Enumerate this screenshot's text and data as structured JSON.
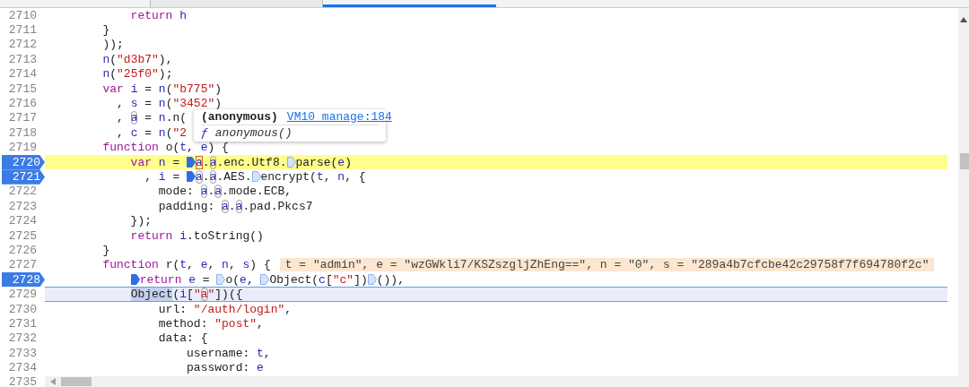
{
  "tab_strip": {
    "tabs": [
      {
        "selected": false
      },
      {
        "selected": true
      }
    ]
  },
  "lines": [
    {
      "number": "2710",
      "tokens": [
        {
          "kind": "kw",
          "text": "            return"
        },
        {
          "kind": "id",
          "text": " h"
        }
      ]
    },
    {
      "number": "2711",
      "tokens": [
        {
          "kind": "txt",
          "text": "        }"
        }
      ]
    },
    {
      "number": "2712",
      "tokens": [
        {
          "kind": "txt",
          "text": "        ));"
        }
      ]
    },
    {
      "number": "2713",
      "tokens": [
        {
          "kind": "id",
          "text": "        n"
        },
        {
          "kind": "txt",
          "text": "("
        },
        {
          "kind": "str",
          "text": "\"d3b7\""
        },
        {
          "kind": "txt",
          "text": "),"
        }
      ]
    },
    {
      "number": "2714",
      "tokens": [
        {
          "kind": "id",
          "text": "        n"
        },
        {
          "kind": "txt",
          "text": "("
        },
        {
          "kind": "str",
          "text": "\"25f0\""
        },
        {
          "kind": "txt",
          "text": ");"
        }
      ]
    },
    {
      "number": "2715",
      "tokens": [
        {
          "kind": "kw",
          "text": "        var"
        },
        {
          "kind": "id",
          "text": " i"
        },
        {
          "kind": "txt",
          "text": " = "
        },
        {
          "kind": "id",
          "text": "n"
        },
        {
          "kind": "txt",
          "text": "("
        },
        {
          "kind": "str",
          "text": "\"b775\""
        },
        {
          "kind": "txt",
          "text": ")"
        }
      ]
    },
    {
      "number": "2716",
      "tokens": [
        {
          "kind": "txt",
          "text": "          , "
        },
        {
          "kind": "id",
          "text": "s"
        },
        {
          "kind": "txt",
          "text": " = "
        },
        {
          "kind": "id",
          "text": "n"
        },
        {
          "kind": "txt",
          "text": "("
        },
        {
          "kind": "str",
          "text": "\"3452\""
        },
        {
          "kind": "txt",
          "text": ")"
        }
      ]
    },
    {
      "number": "2717",
      "tokens": [
        {
          "kind": "txt",
          "text": "          , "
        },
        {
          "kind": "ref",
          "text": "a"
        },
        {
          "kind": "txt",
          "text": " = "
        },
        {
          "kind": "id",
          "text": "n"
        },
        {
          "kind": "txt",
          "text": ".n("
        }
      ]
    },
    {
      "number": "2718",
      "tokens": [
        {
          "kind": "txt",
          "text": "          , "
        },
        {
          "kind": "id",
          "text": "c"
        },
        {
          "kind": "txt",
          "text": " = "
        },
        {
          "kind": "id",
          "text": "n"
        },
        {
          "kind": "txt",
          "text": "("
        },
        {
          "kind": "str",
          "text": "\"2"
        }
      ]
    },
    {
      "number": "2719",
      "tokens": [
        {
          "kind": "kw",
          "text": "        function"
        },
        {
          "kind": "txt",
          "text": " o("
        },
        {
          "kind": "id",
          "text": "t"
        },
        {
          "kind": "txt",
          "text": ", "
        },
        {
          "kind": "id",
          "text": "e"
        },
        {
          "kind": "txt",
          "text": ") {"
        }
      ]
    },
    {
      "number": "2720",
      "breakpoint": true,
      "paused": true,
      "tokens": [
        {
          "kind": "kw",
          "text": "            var"
        },
        {
          "kind": "id",
          "text": " n"
        },
        {
          "kind": "txt",
          "text": " = "
        },
        {
          "kind": "ref-hot",
          "text": "a",
          "bp": true
        },
        {
          "kind": "txt",
          "text": "."
        },
        {
          "kind": "ref",
          "text": "a"
        },
        {
          "kind": "txt",
          "text": ".enc.Utf8."
        },
        {
          "kind": "txt",
          "text": "parse(",
          "bp": false
        },
        {
          "kind": "id",
          "text": "e"
        },
        {
          "kind": "txt",
          "text": ")"
        }
      ]
    },
    {
      "number": "2721",
      "breakpoint": true,
      "tokens": [
        {
          "kind": "txt",
          "text": "              , "
        },
        {
          "kind": "id",
          "text": "i"
        },
        {
          "kind": "txt",
          "text": " = "
        },
        {
          "kind": "ref",
          "text": "a",
          "bp": true
        },
        {
          "kind": "txt",
          "text": "."
        },
        {
          "kind": "ref",
          "text": "a"
        },
        {
          "kind": "txt",
          "text": ".AES."
        },
        {
          "kind": "txt",
          "text": "encrypt(",
          "bp": false
        },
        {
          "kind": "id",
          "text": "t"
        },
        {
          "kind": "txt",
          "text": ", "
        },
        {
          "kind": "id",
          "text": "n"
        },
        {
          "kind": "txt",
          "text": ", {"
        }
      ]
    },
    {
      "number": "2722",
      "tokens": [
        {
          "kind": "txt",
          "text": "                mode: "
        },
        {
          "kind": "ref",
          "text": "a"
        },
        {
          "kind": "txt",
          "text": "."
        },
        {
          "kind": "ref",
          "text": "a"
        },
        {
          "kind": "txt",
          "text": ".mode.ECB,"
        }
      ]
    },
    {
      "number": "2723",
      "tokens": [
        {
          "kind": "txt",
          "text": "                padding: "
        },
        {
          "kind": "ref",
          "text": "a"
        },
        {
          "kind": "txt",
          "text": "."
        },
        {
          "kind": "ref",
          "text": "a"
        },
        {
          "kind": "txt",
          "text": ".pad.Pkcs7"
        }
      ]
    },
    {
      "number": "2724",
      "tokens": [
        {
          "kind": "txt",
          "text": "            });"
        }
      ]
    },
    {
      "number": "2725",
      "tokens": [
        {
          "kind": "kw",
          "text": "            return"
        },
        {
          "kind": "id",
          "text": " i"
        },
        {
          "kind": "txt",
          "text": ".toString()"
        }
      ]
    },
    {
      "number": "2726",
      "tokens": [
        {
          "kind": "txt",
          "text": "        }"
        }
      ]
    },
    {
      "number": "2727",
      "inline_values": "t = \"admin\", e = \"wzGWkli7/KSZszgljZhEng==\", n = \"0\", s = \"289a4b7cfcbe42c29758f7f694780f2c\"",
      "tokens": [
        {
          "kind": "kw",
          "text": "        function"
        },
        {
          "kind": "txt",
          "text": " r("
        },
        {
          "kind": "id",
          "text": "t"
        },
        {
          "kind": "txt",
          "text": ", "
        },
        {
          "kind": "id",
          "text": "e"
        },
        {
          "kind": "txt",
          "text": ", "
        },
        {
          "kind": "id",
          "text": "n"
        },
        {
          "kind": "txt",
          "text": ", "
        },
        {
          "kind": "id",
          "text": "s"
        },
        {
          "kind": "txt",
          "text": ") {"
        }
      ]
    },
    {
      "number": "2728",
      "breakpoint": true,
      "tokens": [
        {
          "kind": "kw",
          "text": "            return",
          "bp": true
        },
        {
          "kind": "id",
          "text": " e"
        },
        {
          "kind": "txt",
          "text": " = "
        },
        {
          "kind": "txt",
          "text": "o(",
          "bp": false
        },
        {
          "kind": "id",
          "text": "e"
        },
        {
          "kind": "txt",
          "text": ", "
        },
        {
          "kind": "txt",
          "text": "Object(",
          "bp": false
        },
        {
          "kind": "id",
          "text": "c"
        },
        {
          "kind": "txt",
          "text": "["
        },
        {
          "kind": "str",
          "text": "\"c\""
        },
        {
          "kind": "txt",
          "text": "])"
        },
        {
          "kind": "txt",
          "text": "()),",
          "bp": false
        }
      ]
    },
    {
      "number": "2729",
      "current": true,
      "tokens": [
        {
          "kind": "sel",
          "text": "            Object"
        },
        {
          "kind": "txt",
          "text": "("
        },
        {
          "kind": "id",
          "text": "i"
        },
        {
          "kind": "txt",
          "text": "["
        },
        {
          "kind": "str",
          "text": "\""
        },
        {
          "kind": "ref-str",
          "text": "a"
        },
        {
          "kind": "str",
          "text": "\""
        },
        {
          "kind": "txt",
          "text": "])({"
        }
      ]
    },
    {
      "number": "2730",
      "tokens": [
        {
          "kind": "txt",
          "text": "                url: "
        },
        {
          "kind": "str",
          "text": "\"/auth/login\""
        },
        {
          "kind": "txt",
          "text": ","
        }
      ]
    },
    {
      "number": "2731",
      "tokens": [
        {
          "kind": "txt",
          "text": "                method: "
        },
        {
          "kind": "str",
          "text": "\"post\""
        },
        {
          "kind": "txt",
          "text": ","
        }
      ]
    },
    {
      "number": "2732",
      "tokens": [
        {
          "kind": "txt",
          "text": "                data: {"
        }
      ]
    },
    {
      "number": "2733",
      "tokens": [
        {
          "kind": "txt",
          "text": "                    username: "
        },
        {
          "kind": "id",
          "text": "t"
        },
        {
          "kind": "txt",
          "text": ","
        }
      ]
    },
    {
      "number": "2734",
      "tokens": [
        {
          "kind": "txt",
          "text": "                    password: "
        },
        {
          "kind": "id",
          "text": "e"
        }
      ]
    },
    {
      "number": "2735"
    }
  ],
  "popup": {
    "title": "(anonymous)",
    "link": "VM10 manage:184",
    "glyph": "ƒ",
    "signature": "anonymous()"
  }
}
